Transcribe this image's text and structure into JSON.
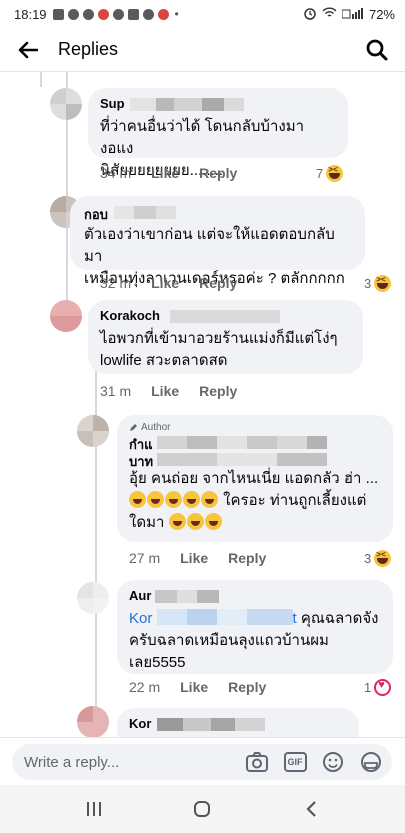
{
  "status": {
    "time": "18:19",
    "dot": "•",
    "battery": "72%"
  },
  "header": {
    "title": "Replies"
  },
  "comments": [
    {
      "author_visible": "Sup",
      "text_lines": [
        "ที่ว่าคนอื่นว่าได้ โดนกลับบ้างมางอแง",
        "นิสัยยยยยยยย........"
      ],
      "time": "34 m",
      "like": "Like",
      "reply": "Reply",
      "reaction_count": "7",
      "reaction": "laugh"
    },
    {
      "author_visible": "กอบ",
      "text_lines": [
        "ตัวเองว่าเขาก่อน แต่จะให้แอดตอบกลับมา",
        "เหมือนทุ่งลาเวนเดอร์หรอค่ะ ? ตลักกกกก"
      ],
      "time": "32 m",
      "like": "Like",
      "reply": "Reply",
      "reaction_count": "3",
      "reaction": "laugh"
    },
    {
      "author_visible": "Korakoch",
      "text_lines": [
        "ไอพวกที่เข้ามาอวยร้านแม่งก็มีแต่โง่ๆ",
        "lowlife สวะตลาดสด"
      ],
      "time": "31 m",
      "like": "Like",
      "reply": "Reply"
    },
    {
      "badge": "Author",
      "author_visible": "กำแ",
      "author_line2": "บาท",
      "text_line1": "อุ้ย คนถ่อย จากไหนเนี่ย แอดกลัว ฮ่า ...",
      "text_line2_suffix": " ใครอะ ท่านถูกเลี้ยงแต่",
      "text_line3_prefix": "ใดมา ",
      "time": "27 m",
      "like": "Like",
      "reply": "Reply",
      "reaction_count": "3",
      "reaction": "laugh"
    },
    {
      "author_visible": "Aur",
      "mention_visible": "Kor",
      "mention_tail": "t",
      "text_line1_suffix": " คุณฉลาดจัง",
      "text_lines": [
        "ครับฉลาดเหมือนลุงแถวบ้านผม",
        "เลย5555"
      ],
      "time": "22 m",
      "like": "Like",
      "reply": "Reply",
      "reaction_count": "1",
      "reaction": "love"
    },
    {
      "author_visible": "Kor"
    }
  ],
  "composer": {
    "placeholder": "Write a reply...",
    "gif_label": "GIF"
  },
  "colors": {
    "link": "#216fdb",
    "bubble": "#f0f2f5",
    "meta": "#65676b"
  },
  "icons": [
    "back-arrow-icon",
    "search-icon",
    "camera-icon",
    "gif-icon",
    "emoji-icon",
    "sticker-icon",
    "recent-apps-icon",
    "home-icon",
    "back-icon"
  ]
}
